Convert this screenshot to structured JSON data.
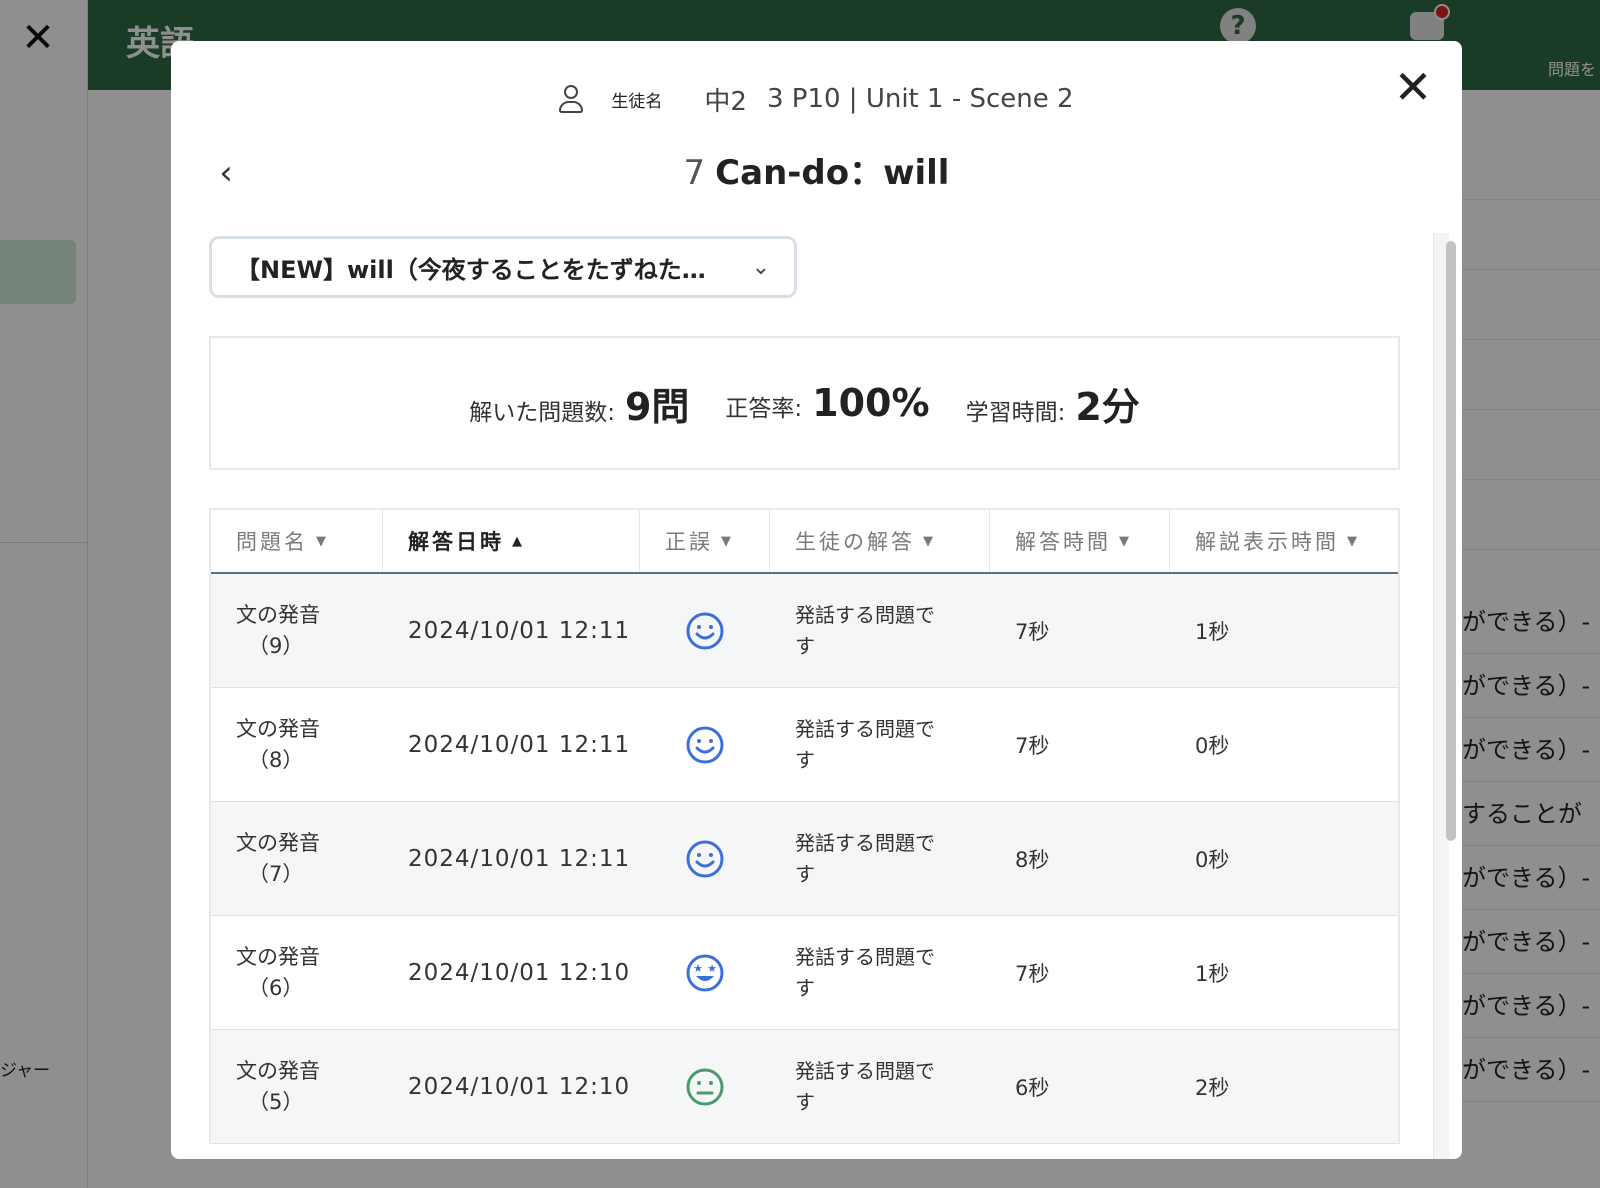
{
  "background": {
    "subject": "英語",
    "header_label": "問題を",
    "left_text": "ジャー",
    "right_rows": [
      "ができる）- I",
      "ができる）- I",
      "ができる）- I",
      "することが",
      "ができる）- I",
      "ができる）- I",
      "ができる）- I",
      "ができる）- I"
    ]
  },
  "modal": {
    "student_label": "生徒名",
    "grade": "中2",
    "unit": "3 P10 | Unit 1 - Scene 2",
    "lesson_number": "7",
    "lesson_title": "Can-do：will",
    "select_value": "【NEW】will（今夜することをたずねた…",
    "stats": {
      "solved_label": "解いた問題数:",
      "solved_value": "9問",
      "accuracy_label": "正答率:",
      "accuracy_value": "100%",
      "time_label": "学習時間:",
      "time_value": "2分"
    },
    "table": {
      "headers": [
        "問題名",
        "解答日時",
        "正誤",
        "生徒の解答",
        "解答時間",
        "解説表示時間"
      ],
      "sort_active_index": 1,
      "rows": [
        {
          "name": "文の発音",
          "num": "（9）",
          "date": "2024/10/01 12:11",
          "face": "smile",
          "answer_1": "発話する問題で",
          "answer_2": "す",
          "answer_time": "7秒",
          "explain_time": "1秒"
        },
        {
          "name": "文の発音",
          "num": "（8）",
          "date": "2024/10/01 12:11",
          "face": "smile",
          "answer_1": "発話する問題で",
          "answer_2": "す",
          "answer_time": "7秒",
          "explain_time": "0秒"
        },
        {
          "name": "文の発音",
          "num": "（7）",
          "date": "2024/10/01 12:11",
          "face": "smile",
          "answer_1": "発話する問題で",
          "answer_2": "す",
          "answer_time": "8秒",
          "explain_time": "0秒"
        },
        {
          "name": "文の発音",
          "num": "（6）",
          "date": "2024/10/01 12:10",
          "face": "star",
          "answer_1": "発話する問題で",
          "answer_2": "す",
          "answer_time": "7秒",
          "explain_time": "1秒"
        },
        {
          "name": "文の発音",
          "num": "（5）",
          "date": "2024/10/01 12:10",
          "face": "neutral",
          "answer_1": "発話する問題で",
          "answer_2": "す",
          "answer_time": "6秒",
          "explain_time": "2秒"
        }
      ]
    }
  },
  "colors": {
    "header_green": "#2f6b44",
    "face_blue": "#3d6fd8",
    "face_green": "#4a9a6e"
  },
  "icons": {
    "close": "close-icon",
    "back": "chevron-left-icon",
    "dropdown": "chevron-down-icon",
    "user": "user-icon",
    "help": "help-icon",
    "chat": "chat-icon"
  }
}
